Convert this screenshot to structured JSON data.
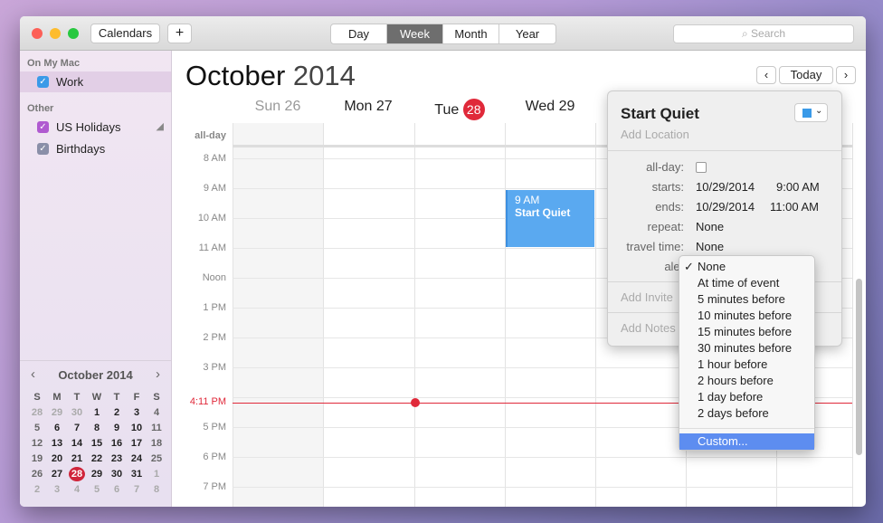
{
  "toolbar": {
    "calendars": "Calendars",
    "add": "+",
    "views": [
      "Day",
      "Week",
      "Month",
      "Year"
    ],
    "active_view": "Week",
    "search_placeholder": "Search"
  },
  "sidebar": {
    "section1": "On My Mac",
    "work": "Work",
    "section2": "Other",
    "us_holidays": "US Holidays",
    "birthdays": "Birthdays",
    "colors": {
      "work": "#3a9ae8",
      "us_holidays": "#b05ad0",
      "birthdays": "#8a8fa8"
    }
  },
  "mini_cal": {
    "title": "October 2014",
    "weekdays": [
      "S",
      "M",
      "T",
      "W",
      "T",
      "F",
      "S"
    ],
    "days": [
      "28",
      "29",
      "30",
      "1",
      "2",
      "3",
      "4",
      "5",
      "6",
      "7",
      "8",
      "9",
      "10",
      "11",
      "12",
      "13",
      "14",
      "15",
      "16",
      "17",
      "18",
      "19",
      "20",
      "21",
      "22",
      "23",
      "24",
      "25",
      "26",
      "27",
      "28",
      "29",
      "30",
      "31",
      "1",
      "2",
      "3",
      "4",
      "5",
      "6",
      "7",
      "8"
    ],
    "today": "28"
  },
  "header": {
    "month": "October",
    "year": "2014",
    "today": "Today"
  },
  "days": [
    "Sun 26",
    "Mon 27",
    "Tue",
    "Wed 29"
  ],
  "today_badge": "28",
  "hours": {
    "allday": "all-day",
    "h": [
      "8 AM",
      "9 AM",
      "10 AM",
      "11 AM",
      "Noon",
      "1 PM",
      "2 PM",
      "3 PM",
      "",
      "5 PM",
      "6 PM",
      "7 PM"
    ],
    "now": "4:11 PM"
  },
  "event": {
    "time": "9 AM",
    "title": "Start Quiet",
    "color": "#5aa9f0"
  },
  "popover": {
    "title": "Start Quiet",
    "location_placeholder": "Add Location",
    "allday_label": "all-day:",
    "starts_label": "starts:",
    "starts_date": "10/29/2014",
    "starts_time": "9:00 AM",
    "ends_label": "ends:",
    "ends_date": "10/29/2014",
    "ends_time": "11:00 AM",
    "repeat_label": "repeat:",
    "repeat": "None",
    "travel_label": "travel time:",
    "travel": "None",
    "alert_label": "aler",
    "invitees": "Add Invite",
    "notes": "Add Notes"
  },
  "alert_menu": {
    "items": [
      "None",
      "At time of event",
      "5 minutes before",
      "10 minutes before",
      "15 minutes before",
      "30 minutes before",
      "1 hour before",
      "2 hours before",
      "1 day before",
      "2 days before"
    ],
    "checked": "None",
    "custom": "Custom..."
  }
}
